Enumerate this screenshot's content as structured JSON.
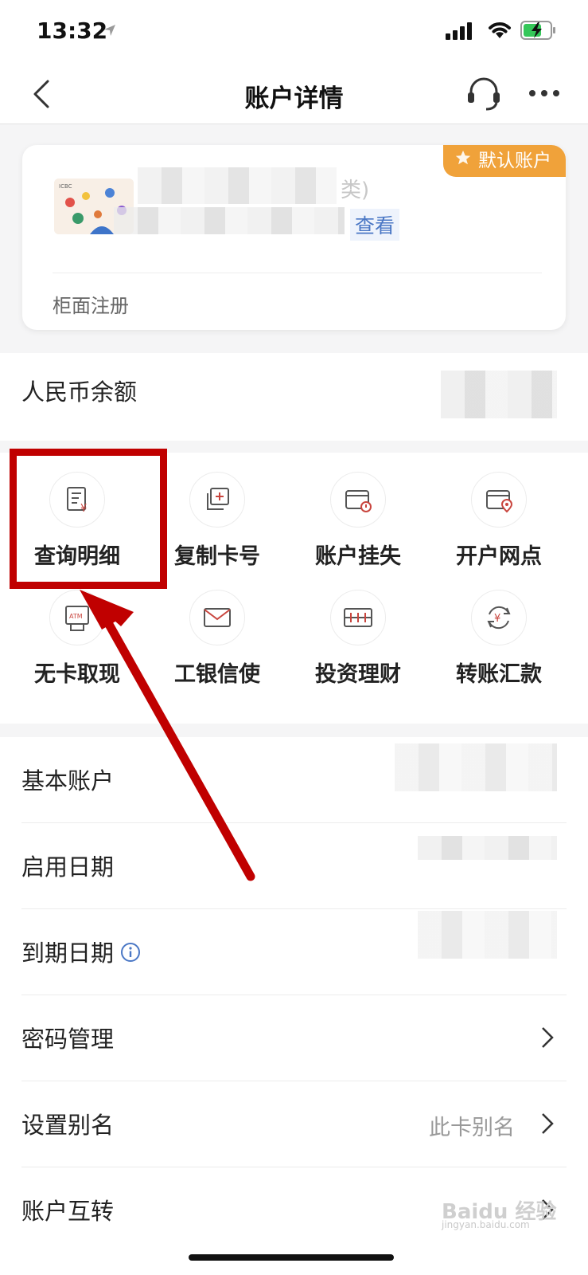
{
  "status": {
    "time": "13:32"
  },
  "nav": {
    "title": "账户详情"
  },
  "card": {
    "badge": "默认账户",
    "type_suffix": "类)",
    "view_link": "查看",
    "footer": "柜面注册"
  },
  "balance": {
    "label": "人民币余额"
  },
  "actions": [
    {
      "label": "查询明细",
      "icon": "statement-icon"
    },
    {
      "label": "复制卡号",
      "icon": "copy-card-icon"
    },
    {
      "label": "账户挂失",
      "icon": "report-loss-icon"
    },
    {
      "label": "开户网点",
      "icon": "branch-location-icon"
    },
    {
      "label": "无卡取现",
      "icon": "atm-icon"
    },
    {
      "label": "工银信使",
      "icon": "envelope-icon"
    },
    {
      "label": "投资理财",
      "icon": "investment-icon"
    },
    {
      "label": "转账汇款",
      "icon": "transfer-icon"
    }
  ],
  "details": [
    {
      "label": "基本账户"
    },
    {
      "label": "启用日期"
    },
    {
      "label": "到期日期"
    },
    {
      "label": "密码管理"
    },
    {
      "label": "设置别名",
      "value": "此卡别名"
    },
    {
      "label": "账户互转"
    }
  ],
  "watermark": {
    "text": "Baidu 经验",
    "sub": "jingyan.baidu.com"
  },
  "colors": {
    "accent": "#f0a23a",
    "annotation": "#c00000",
    "icon_red": "#c9453e",
    "link": "#4a77c5"
  }
}
